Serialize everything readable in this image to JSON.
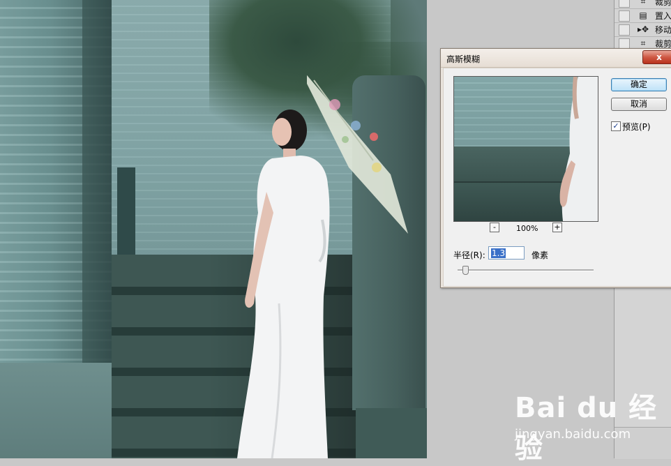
{
  "panel": {
    "items": [
      {
        "label": "裁剪",
        "icon": "crop-icon"
      },
      {
        "label": "置入",
        "icon": "place-icon"
      },
      {
        "label": "移动",
        "icon": "move-icon"
      },
      {
        "label": "裁剪",
        "icon": "crop-icon"
      }
    ]
  },
  "dialog": {
    "title": "高斯模糊",
    "close_label": "x",
    "ok_label": "确定",
    "cancel_label": "取消",
    "preview_label": "预览(P)",
    "preview_checked": true,
    "zoom_out": "-",
    "zoom_in": "+",
    "zoom_level": "100%",
    "radius_label": "半径(R):",
    "radius_value": "1.3",
    "unit_label": "像素",
    "slider_fraction": 0.06
  },
  "watermark": {
    "brand": "Bai du 经验",
    "url": "jingyan.baidu.com"
  },
  "colors": {
    "ok_button": "#bfe2f8",
    "close_button": "#cf5a45",
    "selection": "#3a70c8"
  }
}
